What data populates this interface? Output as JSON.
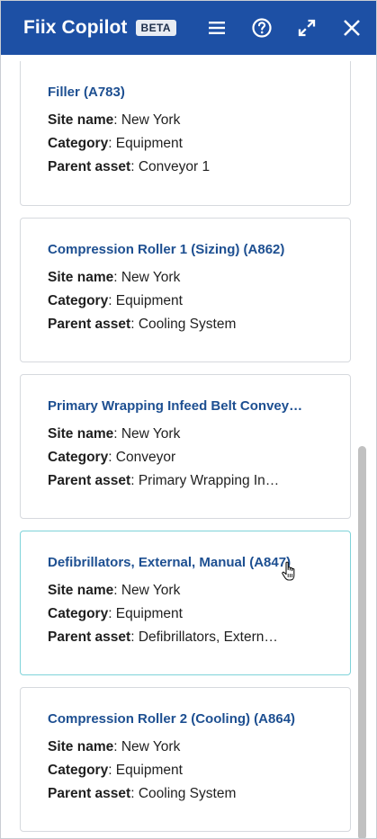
{
  "header": {
    "title": "Fiix Copilot",
    "badge": "BETA",
    "icons": [
      "menu-icon",
      "help-icon",
      "expand-icon",
      "close-icon"
    ],
    "color": "#1d50a5"
  },
  "cards": [
    {
      "title": "Filler (A783)",
      "site_label": "Site name",
      "site": ": New York",
      "category_label": "Category",
      "category": ": Equipment",
      "parent_label": "Parent asset",
      "parent": ": Conveyor 1"
    },
    {
      "title": "Compression Roller 1 (Sizing) (A862)",
      "site_label": "Site name",
      "site": ": New York",
      "category_label": "Category",
      "category": ": Equipment",
      "parent_label": "Parent asset",
      "parent": ": Cooling System"
    },
    {
      "title": "Primary Wrapping Infeed Belt Convey…",
      "site_label": "Site name",
      "site": ": New York",
      "category_label": "Category",
      "category": ": Conveyor",
      "parent_label": "Parent asset",
      "parent": ": Primary Wrapping In…"
    },
    {
      "title": "Defibrillators, External, Manual (A847)",
      "site_label": "Site name",
      "site": ": New York",
      "category_label": "Category",
      "category": ": Equipment",
      "parent_label": "Parent asset",
      "parent": ": Defibrillators, Extern…"
    },
    {
      "title": "Compression Roller 2 (Cooling) (A864)",
      "site_label": "Site name",
      "site": ": New York",
      "category_label": "Category",
      "category": ": Equipment",
      "parent_label": "Parent asset",
      "parent": ": Cooling System"
    }
  ]
}
